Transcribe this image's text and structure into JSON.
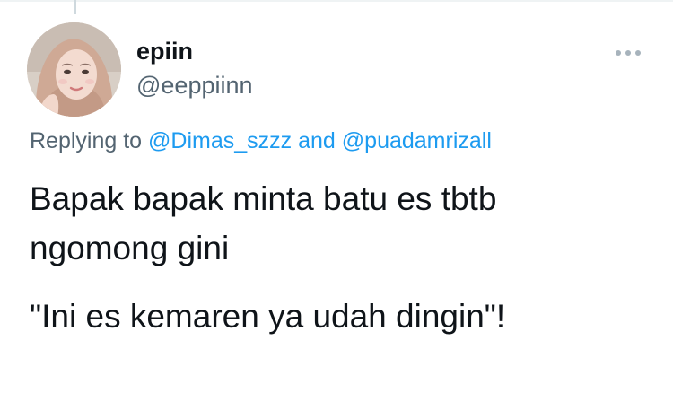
{
  "tweet": {
    "author": {
      "display_name": "epiin",
      "handle": "@eeppiinn",
      "avatar": "profile-photo"
    },
    "more_icon": "more-horizontal-icon",
    "replying": {
      "prefix": "Replying to",
      "mention_1": "@Dimas_szzz",
      "conjunction": "and",
      "mention_2": "@puadamrizall"
    },
    "text": {
      "line_1": "Bapak bapak minta batu es tbtb",
      "line_2": "ngomong gini",
      "line_3": "\"Ini es kemaren ya udah dingin\"!"
    }
  },
  "colors": {
    "text_primary": "#0f1419",
    "text_secondary": "#536471",
    "link": "#1d9bf0",
    "border": "#eff3f4"
  }
}
